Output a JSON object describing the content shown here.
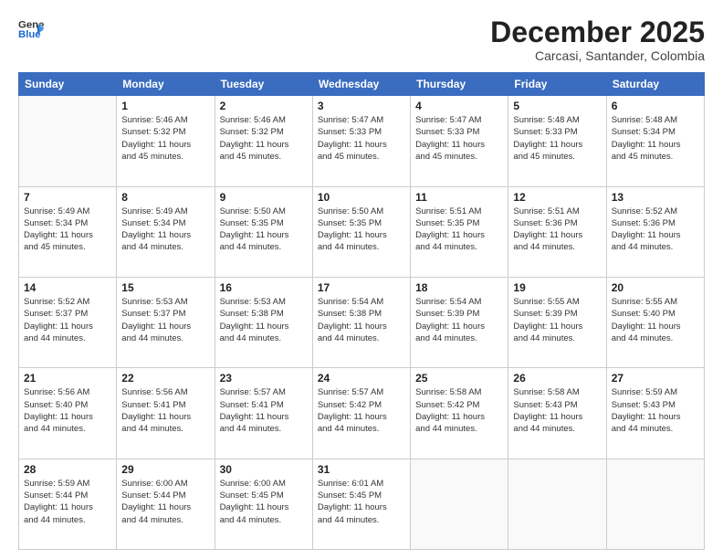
{
  "header": {
    "logo_line1": "General",
    "logo_line2": "Blue",
    "month": "December 2025",
    "location": "Carcasi, Santander, Colombia"
  },
  "days_of_week": [
    "Sunday",
    "Monday",
    "Tuesday",
    "Wednesday",
    "Thursday",
    "Friday",
    "Saturday"
  ],
  "weeks": [
    [
      {
        "num": "",
        "info": ""
      },
      {
        "num": "1",
        "info": "Sunrise: 5:46 AM\nSunset: 5:32 PM\nDaylight: 11 hours\nand 45 minutes."
      },
      {
        "num": "2",
        "info": "Sunrise: 5:46 AM\nSunset: 5:32 PM\nDaylight: 11 hours\nand 45 minutes."
      },
      {
        "num": "3",
        "info": "Sunrise: 5:47 AM\nSunset: 5:33 PM\nDaylight: 11 hours\nand 45 minutes."
      },
      {
        "num": "4",
        "info": "Sunrise: 5:47 AM\nSunset: 5:33 PM\nDaylight: 11 hours\nand 45 minutes."
      },
      {
        "num": "5",
        "info": "Sunrise: 5:48 AM\nSunset: 5:33 PM\nDaylight: 11 hours\nand 45 minutes."
      },
      {
        "num": "6",
        "info": "Sunrise: 5:48 AM\nSunset: 5:34 PM\nDaylight: 11 hours\nand 45 minutes."
      }
    ],
    [
      {
        "num": "7",
        "info": "Sunrise: 5:49 AM\nSunset: 5:34 PM\nDaylight: 11 hours\nand 45 minutes."
      },
      {
        "num": "8",
        "info": "Sunrise: 5:49 AM\nSunset: 5:34 PM\nDaylight: 11 hours\nand 44 minutes."
      },
      {
        "num": "9",
        "info": "Sunrise: 5:50 AM\nSunset: 5:35 PM\nDaylight: 11 hours\nand 44 minutes."
      },
      {
        "num": "10",
        "info": "Sunrise: 5:50 AM\nSunset: 5:35 PM\nDaylight: 11 hours\nand 44 minutes."
      },
      {
        "num": "11",
        "info": "Sunrise: 5:51 AM\nSunset: 5:35 PM\nDaylight: 11 hours\nand 44 minutes."
      },
      {
        "num": "12",
        "info": "Sunrise: 5:51 AM\nSunset: 5:36 PM\nDaylight: 11 hours\nand 44 minutes."
      },
      {
        "num": "13",
        "info": "Sunrise: 5:52 AM\nSunset: 5:36 PM\nDaylight: 11 hours\nand 44 minutes."
      }
    ],
    [
      {
        "num": "14",
        "info": "Sunrise: 5:52 AM\nSunset: 5:37 PM\nDaylight: 11 hours\nand 44 minutes."
      },
      {
        "num": "15",
        "info": "Sunrise: 5:53 AM\nSunset: 5:37 PM\nDaylight: 11 hours\nand 44 minutes."
      },
      {
        "num": "16",
        "info": "Sunrise: 5:53 AM\nSunset: 5:38 PM\nDaylight: 11 hours\nand 44 minutes."
      },
      {
        "num": "17",
        "info": "Sunrise: 5:54 AM\nSunset: 5:38 PM\nDaylight: 11 hours\nand 44 minutes."
      },
      {
        "num": "18",
        "info": "Sunrise: 5:54 AM\nSunset: 5:39 PM\nDaylight: 11 hours\nand 44 minutes."
      },
      {
        "num": "19",
        "info": "Sunrise: 5:55 AM\nSunset: 5:39 PM\nDaylight: 11 hours\nand 44 minutes."
      },
      {
        "num": "20",
        "info": "Sunrise: 5:55 AM\nSunset: 5:40 PM\nDaylight: 11 hours\nand 44 minutes."
      }
    ],
    [
      {
        "num": "21",
        "info": "Sunrise: 5:56 AM\nSunset: 5:40 PM\nDaylight: 11 hours\nand 44 minutes."
      },
      {
        "num": "22",
        "info": "Sunrise: 5:56 AM\nSunset: 5:41 PM\nDaylight: 11 hours\nand 44 minutes."
      },
      {
        "num": "23",
        "info": "Sunrise: 5:57 AM\nSunset: 5:41 PM\nDaylight: 11 hours\nand 44 minutes."
      },
      {
        "num": "24",
        "info": "Sunrise: 5:57 AM\nSunset: 5:42 PM\nDaylight: 11 hours\nand 44 minutes."
      },
      {
        "num": "25",
        "info": "Sunrise: 5:58 AM\nSunset: 5:42 PM\nDaylight: 11 hours\nand 44 minutes."
      },
      {
        "num": "26",
        "info": "Sunrise: 5:58 AM\nSunset: 5:43 PM\nDaylight: 11 hours\nand 44 minutes."
      },
      {
        "num": "27",
        "info": "Sunrise: 5:59 AM\nSunset: 5:43 PM\nDaylight: 11 hours\nand 44 minutes."
      }
    ],
    [
      {
        "num": "28",
        "info": "Sunrise: 5:59 AM\nSunset: 5:44 PM\nDaylight: 11 hours\nand 44 minutes."
      },
      {
        "num": "29",
        "info": "Sunrise: 6:00 AM\nSunset: 5:44 PM\nDaylight: 11 hours\nand 44 minutes."
      },
      {
        "num": "30",
        "info": "Sunrise: 6:00 AM\nSunset: 5:45 PM\nDaylight: 11 hours\nand 44 minutes."
      },
      {
        "num": "31",
        "info": "Sunrise: 6:01 AM\nSunset: 5:45 PM\nDaylight: 11 hours\nand 44 minutes."
      },
      {
        "num": "",
        "info": ""
      },
      {
        "num": "",
        "info": ""
      },
      {
        "num": "",
        "info": ""
      }
    ]
  ]
}
